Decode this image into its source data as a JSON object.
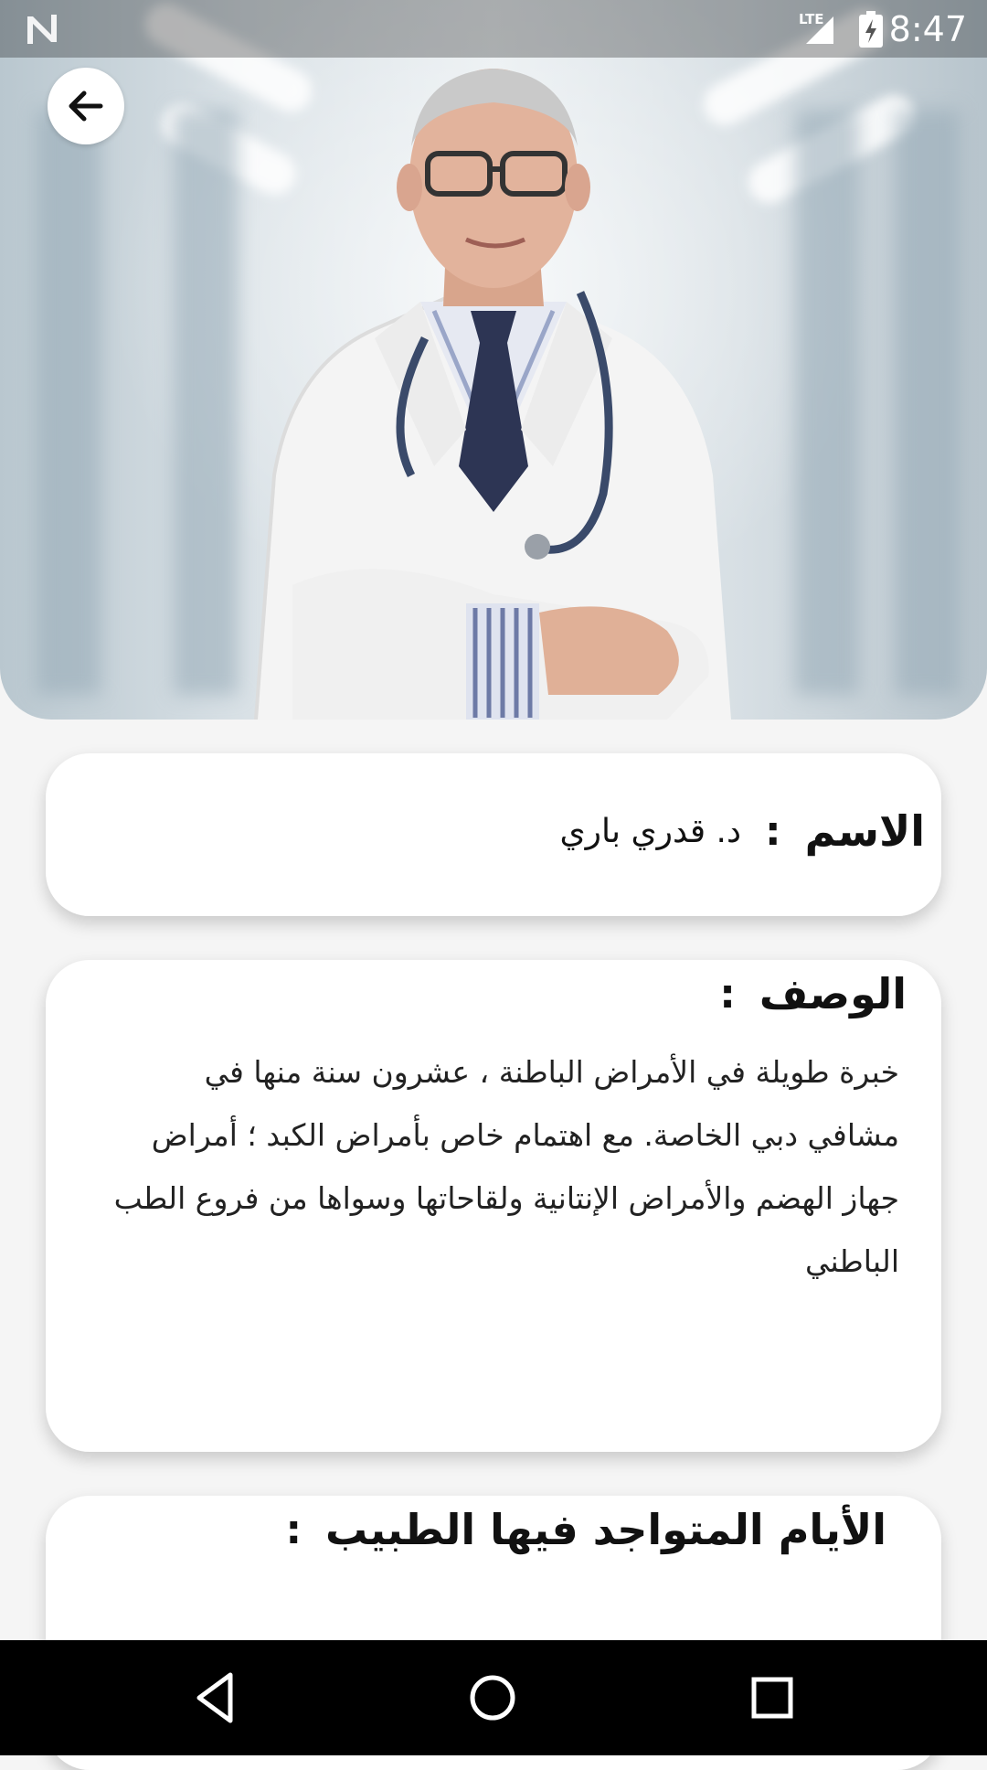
{
  "status_bar": {
    "time": "8:47",
    "network": "LTE",
    "icons": [
      "n-logo-icon",
      "signal-icon",
      "battery-charging-icon"
    ]
  },
  "hero": {
    "image": "doctor-portrait"
  },
  "back_button": {
    "icon": "arrow-left-icon"
  },
  "name_card": {
    "label": "الاسم",
    "separator": ":",
    "value": "د. قدري باري"
  },
  "description_card": {
    "label": "الوصف",
    "separator": ":",
    "text": "خبرة طويلة في الأمراض الباطنة ، عشرون سنة منها في مشافي دبي الخاصة. مع اهتمام خاص بأمراض الكبد ؛ أمراض جهاز الهضم والأمراض الإنتانية ولقاحاتها وسواها من فروع الطب الباطني"
  },
  "days_card": {
    "label": "الأيام المتواجد فيها الطبيب",
    "separator": ":"
  },
  "nav_bar": {
    "buttons": [
      "back-triangle-icon",
      "home-circle-icon",
      "recents-square-icon"
    ]
  }
}
